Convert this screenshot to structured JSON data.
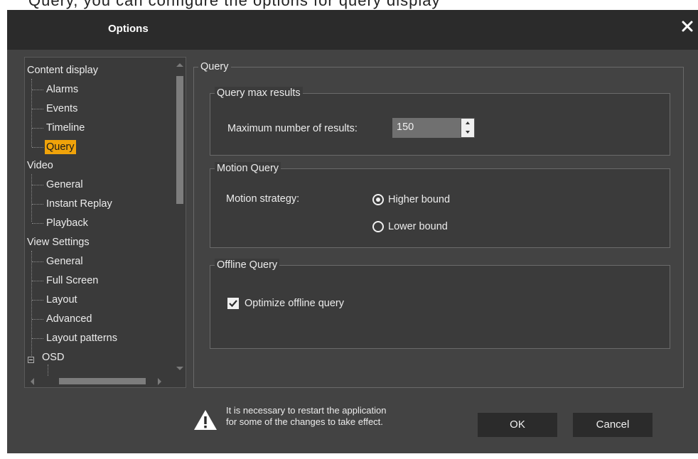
{
  "cropped_top_text": "Query, you can configure the options for query display",
  "dialog": {
    "title": "Options"
  },
  "tree": {
    "items": [
      {
        "label": "Content display",
        "level": 0
      },
      {
        "label": "Alarms",
        "level": 1
      },
      {
        "label": "Events",
        "level": 1
      },
      {
        "label": "Timeline",
        "level": 1
      },
      {
        "label": "Query",
        "level": 1,
        "selected": true
      },
      {
        "label": "Video",
        "level": 0
      },
      {
        "label": "General",
        "level": 1
      },
      {
        "label": "Instant Replay",
        "level": 1
      },
      {
        "label": "Playback",
        "level": 1
      },
      {
        "label": "View Settings",
        "level": 0
      },
      {
        "label": "General",
        "level": 1
      },
      {
        "label": "Full Screen",
        "level": 1
      },
      {
        "label": "Layout",
        "level": 1
      },
      {
        "label": "Advanced",
        "level": 1
      },
      {
        "label": "Layout patterns",
        "level": 1
      },
      {
        "label": "OSD",
        "level": 1,
        "expandable": true,
        "expanded": true
      }
    ]
  },
  "query_group": {
    "title": "Query",
    "max_results": {
      "title": "Query max results",
      "label": "Maximum number of results:",
      "value": "150"
    },
    "motion": {
      "title": "Motion Query",
      "label": "Motion strategy:",
      "options": [
        "Higher bound",
        "Lower bound"
      ],
      "selected": "Higher bound"
    },
    "offline": {
      "title": "Offline Query",
      "checkbox_label": "Optimize offline query",
      "checked": true
    }
  },
  "footer": {
    "warning_line1": "It is necessary to restart the application",
    "warning_line2": "for some of the changes to take effect.",
    "ok_label": "OK",
    "cancel_label": "Cancel"
  },
  "colors": {
    "selection": "#f0a30a",
    "titlebar": "#2b2b2b",
    "dialog_bg": "#434343",
    "panel_bg": "#3b3b3b"
  }
}
